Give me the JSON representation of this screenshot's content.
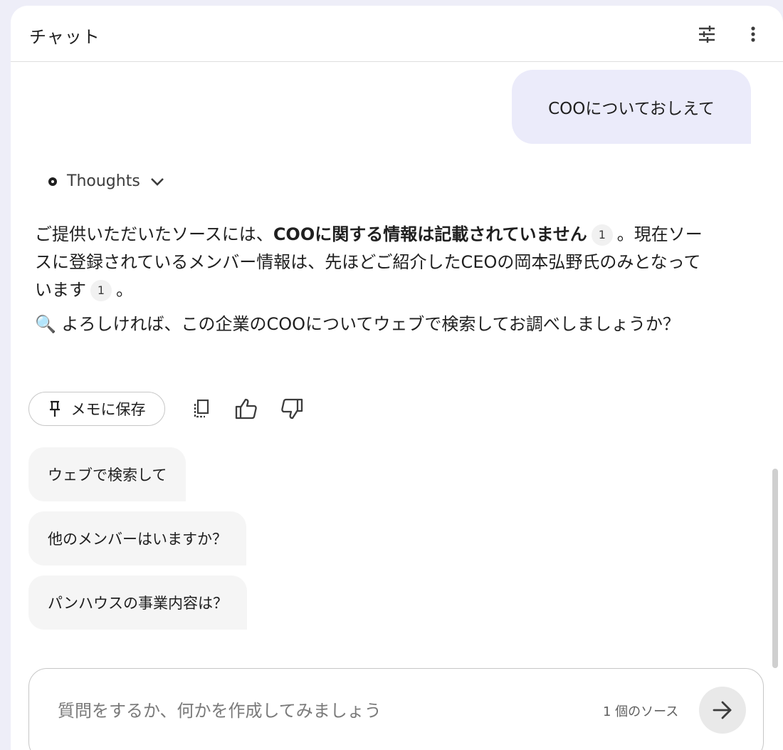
{
  "header": {
    "title": "チャット"
  },
  "user_message": {
    "text": "COOについておしえて"
  },
  "thoughts": {
    "label": "Thoughts"
  },
  "answer": {
    "p1_a": "ご提供いただいたソースには、",
    "p1_bold": "COOに関する情報は記載されていません",
    "p1_cite1": "1",
    "p1_b": "。現在ソースに登録されているメンバー情報は、先ほどご紹介したCEOの岡本弘野氏のみとなっています",
    "p1_cite2": "1",
    "p1_c": "。",
    "p2": "🔍 よろしければ、この企業のCOOについてウェブで検索してお調べしましょうか？"
  },
  "actions": {
    "save_note": "メモに保存"
  },
  "suggestions": [
    {
      "label": "ウェブで検索して"
    },
    {
      "label": "他のメンバーはいますか？"
    },
    {
      "label": "パンハウスの事業内容は？"
    }
  ],
  "composer": {
    "placeholder": "質問をするか、何かを作成してみましょう",
    "source_count": "1 個のソース"
  },
  "colors": {
    "background": "#eeeef8",
    "user_bubble": "#ebebfa",
    "suggestion_bg": "#f5f5f5"
  }
}
